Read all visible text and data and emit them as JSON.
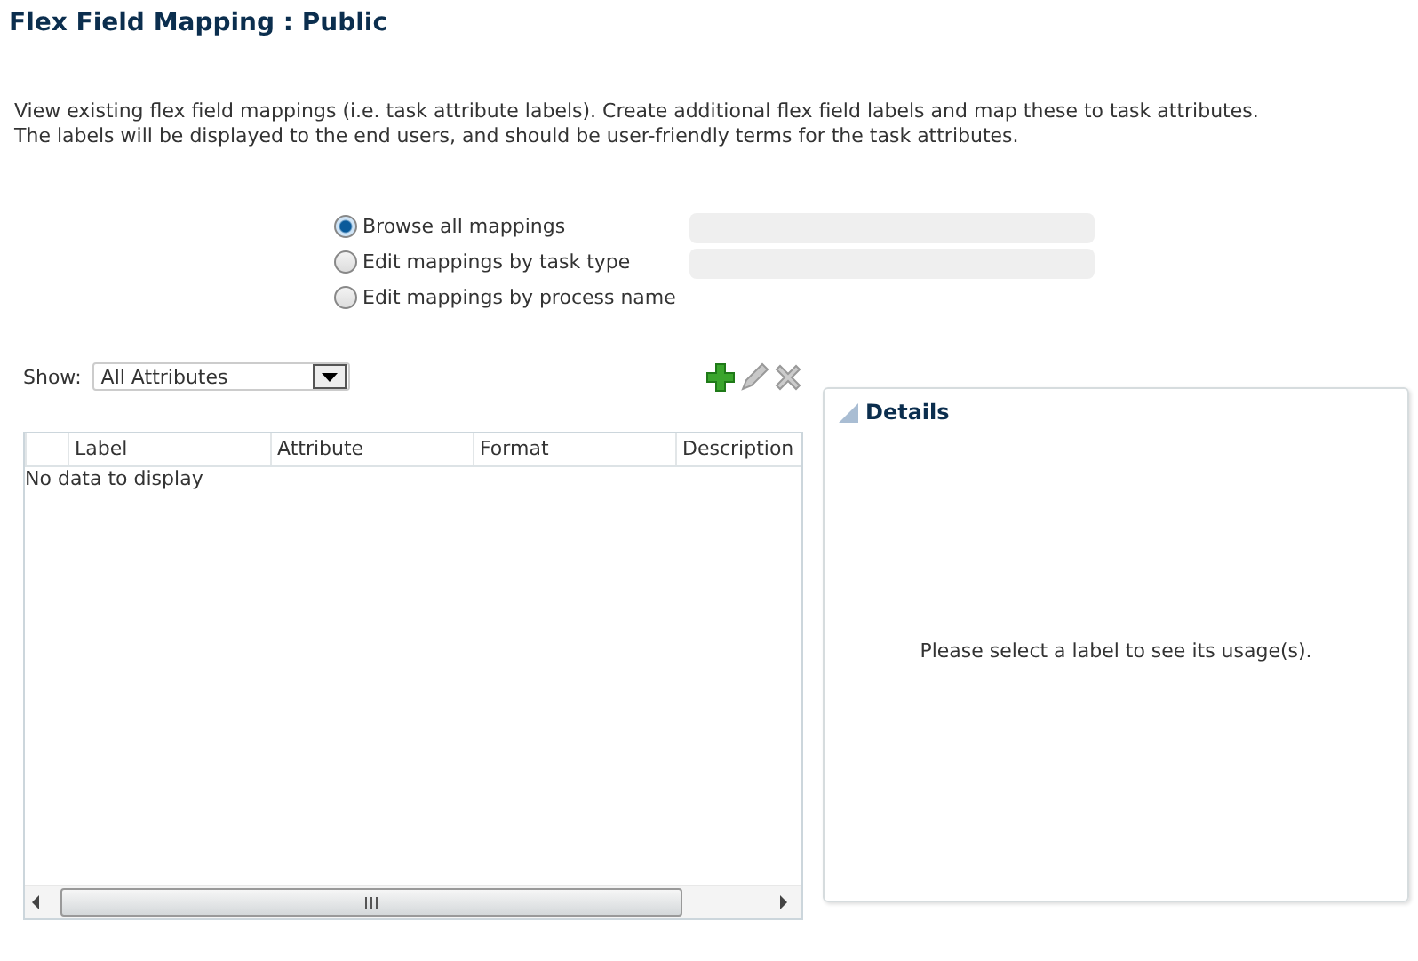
{
  "title": "Flex Field Mapping : Public",
  "description": [
    "View existing flex field mappings (i.e. task attribute labels). Create additional flex field labels and map these to task attributes.",
    "The labels will be displayed to the end users, and should be user-friendly terms for the task attributes."
  ],
  "mapping_options": [
    {
      "label": "Browse all mappings",
      "selected": true
    },
    {
      "label": "Edit mappings by task type",
      "selected": false
    },
    {
      "label": "Edit mappings by process name",
      "selected": false
    }
  ],
  "show": {
    "label": "Show:",
    "value": "All Attributes"
  },
  "table": {
    "columns": [
      "Label",
      "Attribute",
      "Format",
      "Description"
    ],
    "empty_message": "No data to display"
  },
  "details": {
    "title": "Details",
    "expanded": true,
    "message": "Please select a label to see its usage(s)."
  }
}
